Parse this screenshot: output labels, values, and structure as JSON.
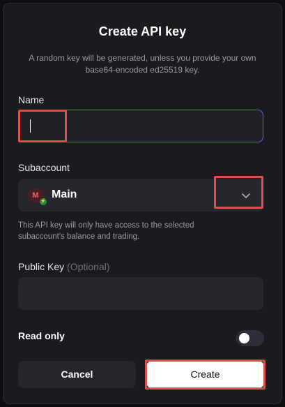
{
  "dialog": {
    "title": "Create API key",
    "description": "A random key will be generated, unless you provide your own base64-encoded ed25519 key."
  },
  "name_field": {
    "label": "Name",
    "value": ""
  },
  "subaccount_field": {
    "label": "Subaccount",
    "avatar_letter": "M",
    "selected_value": "Main",
    "helper_text": "This API key will only have access to the selected subaccount's balance and trading."
  },
  "public_key_field": {
    "label": "Public Key",
    "optional_tag": "(Optional)",
    "value": ""
  },
  "read_only": {
    "label": "Read only",
    "enabled": false
  },
  "buttons": {
    "cancel_label": "Cancel",
    "create_label": "Create"
  },
  "colors": {
    "background": "#1a1a1f",
    "input_focus_border": "#5b6fd8",
    "highlight": "#e04e4e",
    "create_button": "#ffffff"
  },
  "icons": {
    "chevron": "chevron-down-icon",
    "avatar_badge": "lightning-icon"
  }
}
